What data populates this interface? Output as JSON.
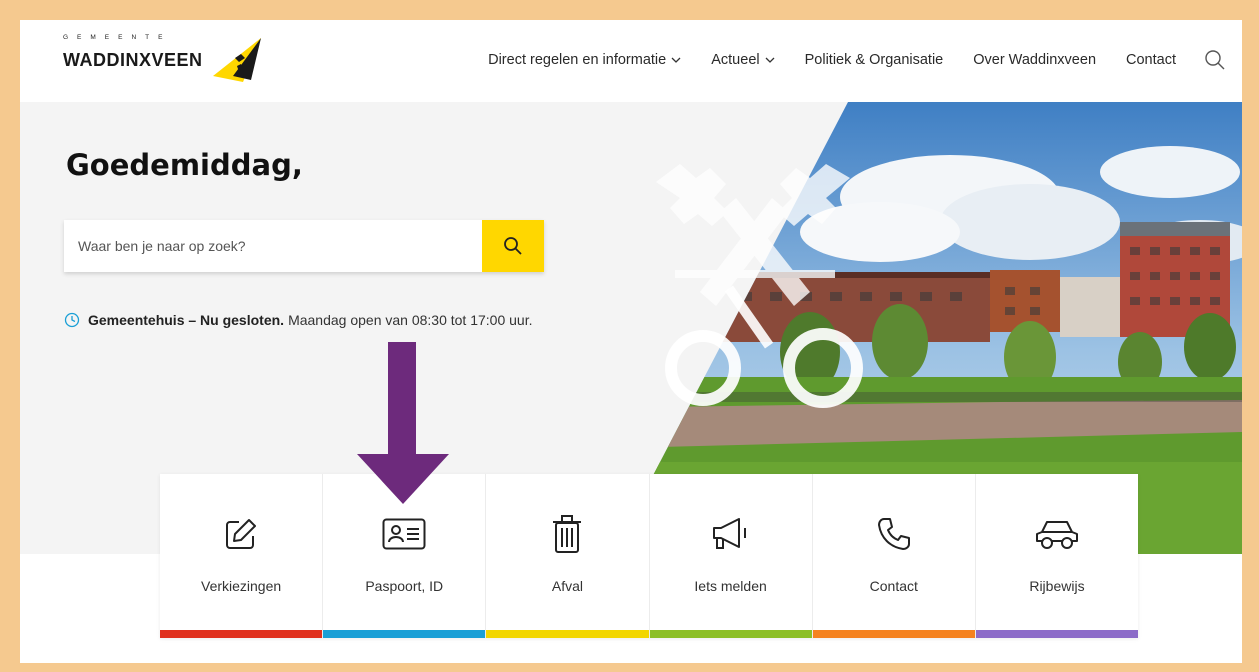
{
  "header": {
    "logo_top": "GEMEENTE",
    "logo_main": "WADDINXVEEN",
    "nav": [
      {
        "label": "Direct regelen en informatie",
        "dropdown": true
      },
      {
        "label": "Actueel",
        "dropdown": true
      },
      {
        "label": "Politiek & Organisatie",
        "dropdown": false
      },
      {
        "label": "Over Waddinxveen",
        "dropdown": false
      },
      {
        "label": "Contact",
        "dropdown": false
      }
    ]
  },
  "hero": {
    "greeting": "Goedemiddag,",
    "search_placeholder": "Waar ben je naar op zoek?",
    "status_bold": "Gemeentehuis – Nu gesloten.",
    "status_rest": "Maandag open van 08:30 tot 17:00 uur."
  },
  "tiles": [
    {
      "label": "Verkiezingen",
      "icon": "edit-icon",
      "color": "#e0301e"
    },
    {
      "label": "Paspoort, ID",
      "icon": "id-card-icon",
      "color": "#1a9fd6"
    },
    {
      "label": "Afval",
      "icon": "trash-icon",
      "color": "#f2d600"
    },
    {
      "label": "Iets melden",
      "icon": "megaphone-icon",
      "color": "#8cbf26"
    },
    {
      "label": "Contact",
      "icon": "phone-icon",
      "color": "#f5821f"
    },
    {
      "label": "Rijbewijs",
      "icon": "car-icon",
      "color": "#8c6bc8"
    }
  ],
  "colors": {
    "accent_yellow": "#ffd700",
    "annotation_arrow": "#6d2a7c",
    "frame": "#f5c98f"
  }
}
